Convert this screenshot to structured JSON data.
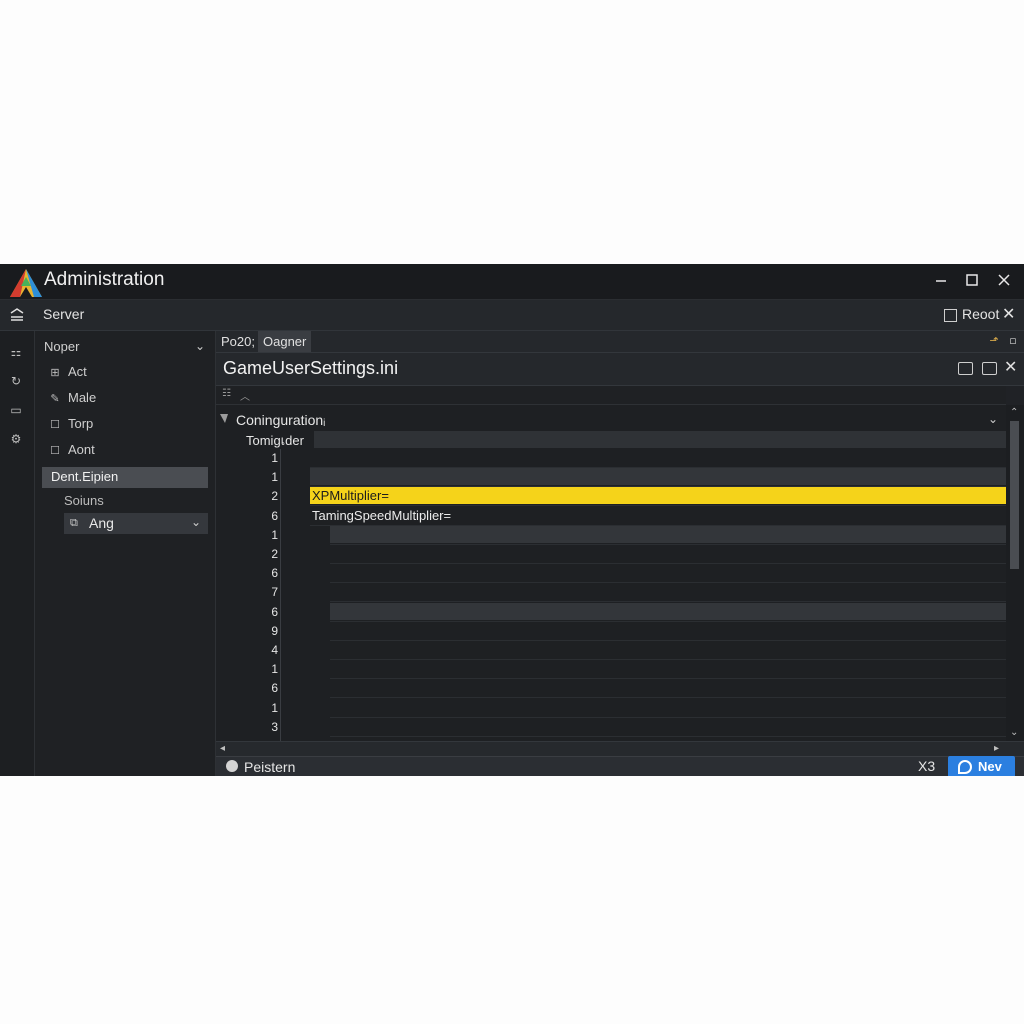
{
  "window": {
    "title": "Administration"
  },
  "menubar": {
    "server_label": "Server",
    "reset_label": "Reoot"
  },
  "sidebar": {
    "header": "Noper",
    "items": [
      {
        "label": "Act",
        "icon": "grid-icon"
      },
      {
        "label": "Male",
        "icon": "pencil-icon"
      },
      {
        "label": "Torp",
        "icon": "square-icon"
      },
      {
        "label": "Aont",
        "icon": "square-icon"
      }
    ],
    "selected_label": "Dent.Eipien",
    "sub_label": "Soiuns",
    "select_value": "Ang"
  },
  "tabs": [
    {
      "label": "Po20;"
    },
    {
      "label": "Oagner"
    }
  ],
  "file": {
    "name": "GameUserSettings.ini"
  },
  "editor": {
    "section_title": "Coningurationᵢ",
    "subsection_title": "Tomigเder",
    "rows": [
      {
        "line": "1",
        "text": "",
        "style": "plain"
      },
      {
        "line": "1",
        "text": "",
        "style": "shaded"
      },
      {
        "line": "2",
        "text": "XPMultiplier=",
        "style": "highlight"
      },
      {
        "line": "6",
        "text": "TamingSpeedMultiplier=",
        "style": "plain"
      },
      {
        "line": "1",
        "text": "",
        "style": "shaded"
      },
      {
        "line": "2",
        "text": "",
        "style": "plain"
      },
      {
        "line": "6",
        "text": "",
        "style": "plain"
      },
      {
        "line": "7",
        "text": "",
        "style": "plain"
      },
      {
        "line": "6",
        "text": "",
        "style": "shaded"
      },
      {
        "line": "9",
        "text": "",
        "style": "plain"
      },
      {
        "line": "4",
        "text": "",
        "style": "plain"
      },
      {
        "line": "1",
        "text": "",
        "style": "plain"
      },
      {
        "line": "6",
        "text": "",
        "style": "plain"
      },
      {
        "line": "1",
        "text": "",
        "style": "plain"
      },
      {
        "line": "3",
        "text": "",
        "style": "plain"
      }
    ]
  },
  "statusbar": {
    "label": "Peistern",
    "close_label": "X3",
    "new_button": "Nev"
  },
  "colors": {
    "accent": "#2b7fe0",
    "highlight": "#f5d31a",
    "background": "#1c1e21"
  }
}
